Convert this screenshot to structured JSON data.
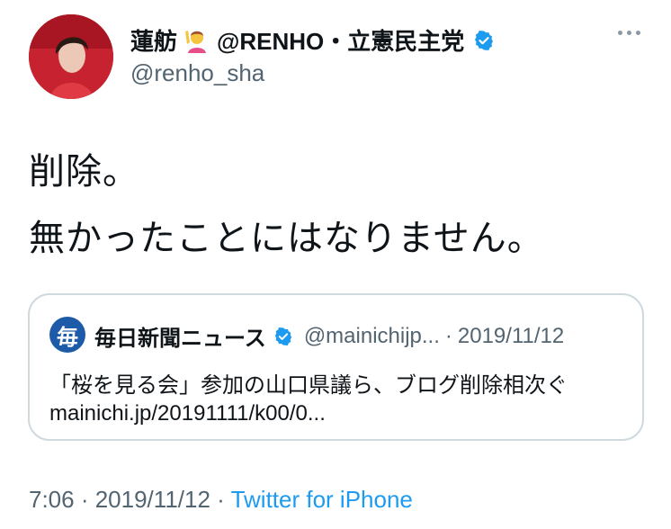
{
  "header": {
    "display_name": "蓮舫",
    "name_suffix": "@RENHO・立憲民主党",
    "handle": "@renho_sha",
    "emoji_icon": "person-raising-hand-icon",
    "verified_icon": "verified-badge-icon",
    "more_icon": "more-options-icon"
  },
  "tweet": {
    "line1": "削除。",
    "line2": "無かったことにはなりません。"
  },
  "quote": {
    "logo_glyph": "毎",
    "name": "毎日新聞ニュース",
    "handle": "@mainichijp...",
    "separator": "·",
    "date": "2019/11/12",
    "line1": "「桜を見る会」参加の山口県議ら、ブログ削除相次ぐ",
    "line2": "mainichi.jp/20191111/k00/0..."
  },
  "footer": {
    "time": "7:06",
    "sep1": " · ",
    "date": "2019/11/12",
    "sep2": " · ",
    "source": "Twitter for iPhone"
  },
  "colors": {
    "text": "#0f1419",
    "secondary": "#536471",
    "link": "#1d9bf0",
    "verified": "#1d9bf0",
    "border": "#cfd9de"
  }
}
